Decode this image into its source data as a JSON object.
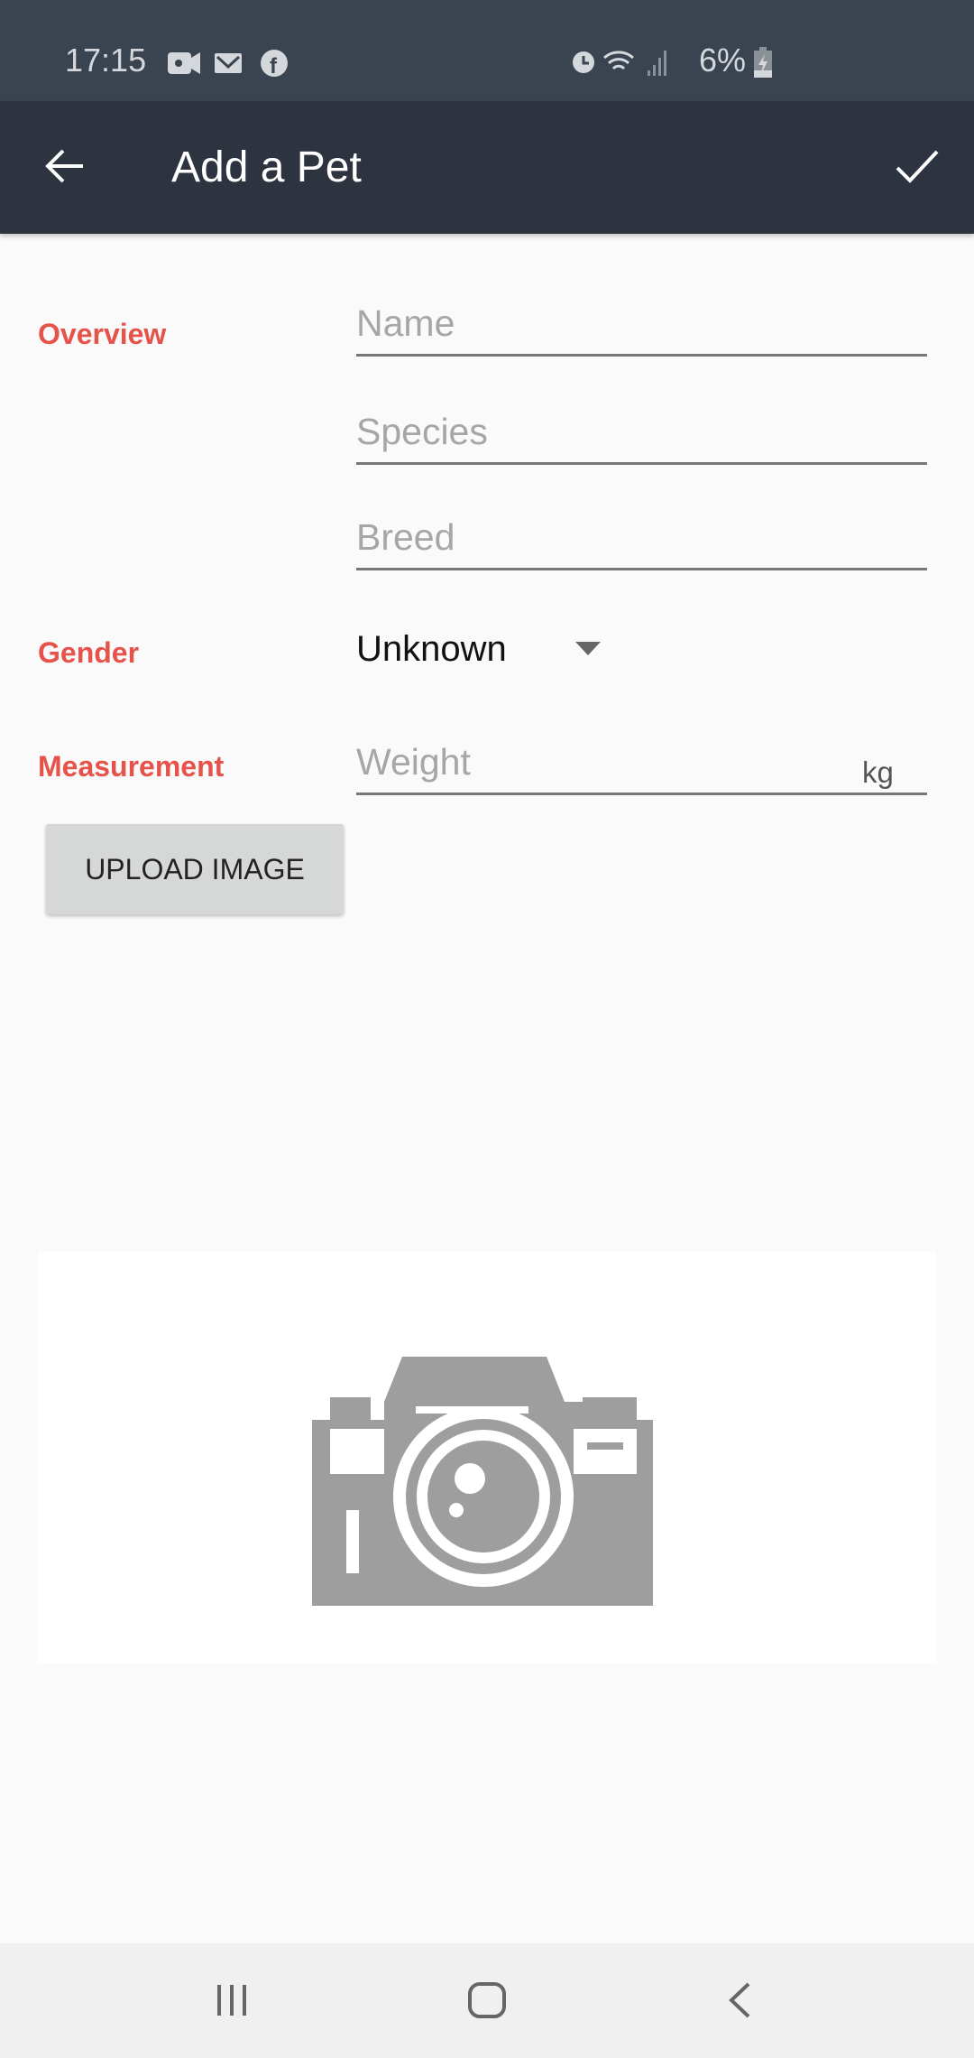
{
  "status_bar": {
    "time": "17:15",
    "battery": "6%",
    "icons": [
      "video-icon",
      "gmail-icon",
      "facebook-icon",
      "dot-icon",
      "alarm-icon",
      "wifi-icon",
      "signal-icon",
      "battery-charging-icon"
    ]
  },
  "app_bar": {
    "title": "Add a Pet",
    "back_icon": "arrow-left-icon",
    "confirm_icon": "check-icon"
  },
  "form": {
    "overview_label": "Overview",
    "name_placeholder": "Name",
    "name_value": "",
    "species_placeholder": "Species",
    "species_value": "",
    "breed_placeholder": "Breed",
    "breed_value": "",
    "gender_label": "Gender",
    "gender_value": "Unknown",
    "measurement_label": "Measurement",
    "weight_placeholder": "Weight",
    "weight_value": "",
    "weight_unit": "kg",
    "upload_label": "UPLOAD IMAGE"
  },
  "image_placeholder": {
    "icon": "camera-icon"
  },
  "nav_bar": {
    "icons": [
      "recents-icon",
      "home-icon",
      "back-icon"
    ]
  },
  "colors": {
    "accent": "#e5534b",
    "app_bar": "#2d3440",
    "status_bar": "#3a4350"
  }
}
